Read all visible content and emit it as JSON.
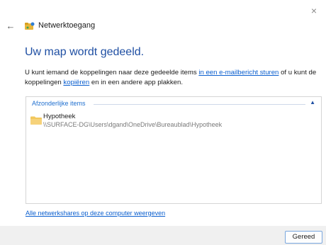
{
  "window": {
    "close_glyph": "×",
    "back_glyph": "←",
    "app_title": "Netwerktoegang"
  },
  "main": {
    "title": "Uw map wordt gedeeld.",
    "desc_part1": "U kunt iemand de koppelingen naar deze gedeelde items ",
    "desc_link_email": "in een e-mailbericht sturen",
    "desc_part2": " of u kunt de koppelingen ",
    "desc_link_copy": "kopiëren",
    "desc_part3": " en in een andere app plakken."
  },
  "items": {
    "header": "Afzonderlijke items",
    "collapse_glyph": "▲",
    "list": [
      {
        "name": "Hypotheek",
        "path": "\\\\SURFACE-DG\\Users\\dgand\\OneDrive\\Bureaublad\\Hypotheek"
      }
    ]
  },
  "links": {
    "shares": "Alle netwerkshares op deze computer weergeven"
  },
  "footer": {
    "done_label": "Gereed"
  }
}
